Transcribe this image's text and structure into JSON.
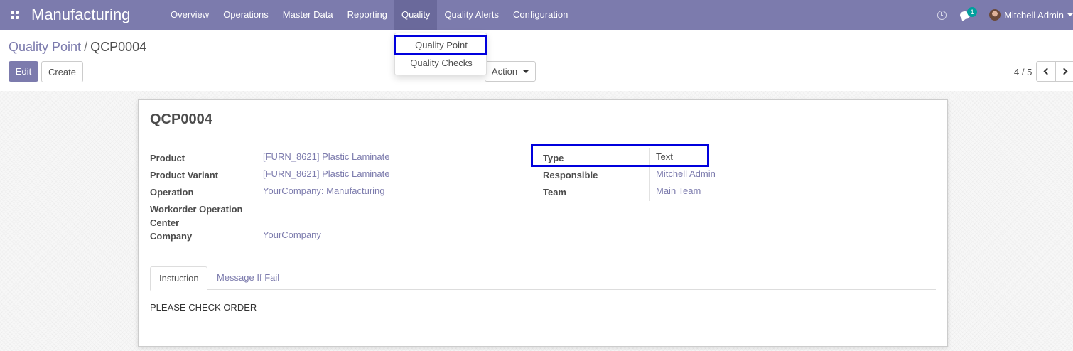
{
  "navbar": {
    "app_name": "Manufacturing",
    "menu": [
      "Overview",
      "Operations",
      "Master Data",
      "Reporting",
      "Quality",
      "Quality Alerts",
      "Configuration"
    ],
    "chat_count": "1",
    "user_name": "Mitchell Admin",
    "accent_color": "#7c7bad"
  },
  "breadcrumb": {
    "parent": "Quality Point",
    "separator": "/",
    "current": "QCP0004"
  },
  "toolbar": {
    "edit_label": "Edit",
    "create_label": "Create",
    "action_label": "Action"
  },
  "pager": {
    "value": "4 / 5"
  },
  "dropdown": {
    "items": [
      "Quality Point",
      "Quality Checks"
    ]
  },
  "record": {
    "title": "QCP0004",
    "left_fields": [
      {
        "label": "Product",
        "value": "[FURN_8621] Plastic Laminate"
      },
      {
        "label": "Product Variant",
        "value": "[FURN_8621] Plastic Laminate"
      },
      {
        "label": "Operation",
        "value": "YourCompany: Manufacturing"
      },
      {
        "label": "Workorder Operation Center",
        "value": ""
      },
      {
        "label": "Company",
        "value": "YourCompany"
      }
    ],
    "right_fields": [
      {
        "label": "Type",
        "value": "Text"
      },
      {
        "label": "Responsible",
        "value": "Mitchell Admin"
      },
      {
        "label": "Team",
        "value": "Main Team"
      }
    ]
  },
  "tabs": [
    "Instuction",
    "Message If Fail"
  ],
  "tab_content": "PLEASE CHECK ORDER",
  "highlight_color": "#0000dd"
}
